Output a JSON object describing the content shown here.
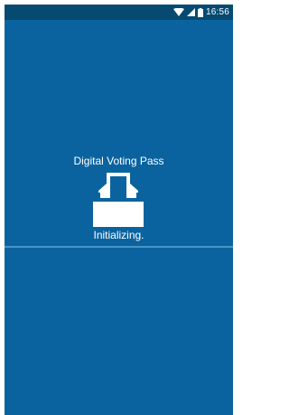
{
  "statusbar": {
    "time": "16:56",
    "icons": [
      "wifi-icon",
      "cell-signal-icon",
      "battery-icon"
    ]
  },
  "splash": {
    "title": "Digital Voting Pass",
    "icon": "ballot-box-icon",
    "status": "Initializing."
  },
  "colors": {
    "background": "#0a639f",
    "statusbar": "#064a72",
    "divider": "#4a95c3",
    "text": "#ffffff"
  }
}
